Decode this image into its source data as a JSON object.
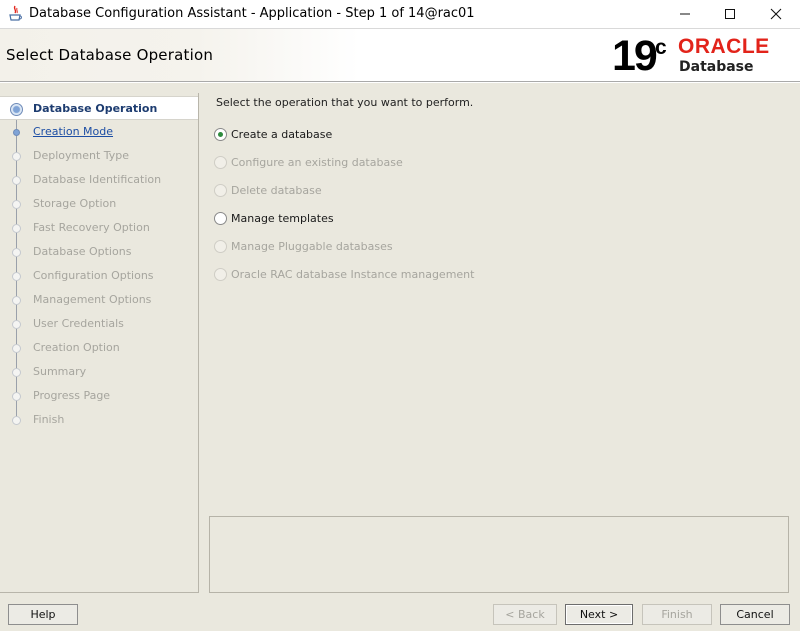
{
  "window": {
    "title": "Database Configuration Assistant - Application - Step 1 of 14@rac01"
  },
  "header": {
    "page_title": "Select Database Operation",
    "logo_version": "19",
    "logo_version_sup": "c",
    "logo_brand": "ORACLE",
    "logo_product": "Database"
  },
  "steps": [
    {
      "label": "Database Operation",
      "state": "current"
    },
    {
      "label": "Creation Mode",
      "state": "link"
    },
    {
      "label": "Deployment Type",
      "state": "disabled"
    },
    {
      "label": "Database Identification",
      "state": "disabled"
    },
    {
      "label": "Storage Option",
      "state": "disabled"
    },
    {
      "label": "Fast Recovery Option",
      "state": "disabled"
    },
    {
      "label": "Database Options",
      "state": "disabled"
    },
    {
      "label": "Configuration Options",
      "state": "disabled"
    },
    {
      "label": "Management Options",
      "state": "disabled"
    },
    {
      "label": "User Credentials",
      "state": "disabled"
    },
    {
      "label": "Creation Option",
      "state": "disabled"
    },
    {
      "label": "Summary",
      "state": "disabled"
    },
    {
      "label": "Progress Page",
      "state": "disabled"
    },
    {
      "label": "Finish",
      "state": "disabled"
    }
  ],
  "content": {
    "prompt": "Select the operation that you want to perform.",
    "options": [
      {
        "label": "Create a database",
        "selected": true,
        "enabled": true
      },
      {
        "label": "Configure an existing database",
        "selected": false,
        "enabled": false
      },
      {
        "label": "Delete database",
        "selected": false,
        "enabled": false
      },
      {
        "label": "Manage templates",
        "selected": false,
        "enabled": true
      },
      {
        "label": "Manage Pluggable databases",
        "selected": false,
        "enabled": false
      },
      {
        "label": "Oracle RAC database Instance management",
        "selected": false,
        "enabled": false
      }
    ]
  },
  "buttons": {
    "help": "Help",
    "back": "< Back",
    "next": "Next >",
    "finish": "Finish",
    "cancel": "Cancel"
  },
  "colors": {
    "oracle_red": "#e2231a",
    "current_step_text": "#1d3c70",
    "link_text": "#1d4ea4",
    "panel_background": "#eae8de",
    "selected_radio": "#2e8b3e"
  }
}
